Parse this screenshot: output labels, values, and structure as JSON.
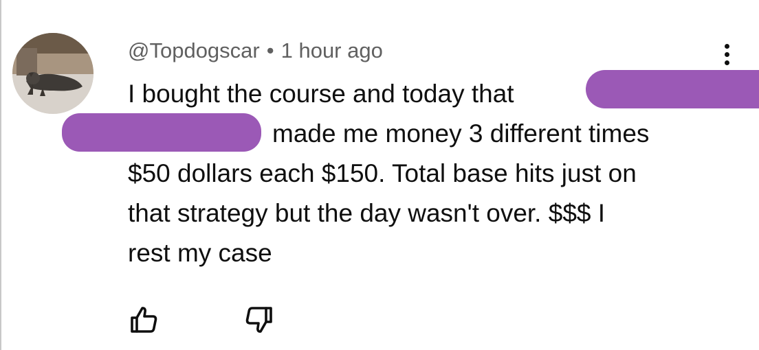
{
  "comment": {
    "author": "@Topdogscar",
    "separator": "•",
    "timestamp": "1 hour ago",
    "lines": [
      "I bought the course and today that",
      "made me money 3 different times",
      "$50 dollars each $150. Total base hits just on",
      "that strategy but the day wasn't over. $$$ I",
      "rest my case"
    ]
  },
  "icons": {
    "avatar": "dog-photo-avatar",
    "more": "more-vertical-icon",
    "like": "thumbs-up-icon",
    "dislike": "thumbs-down-icon"
  },
  "colors": {
    "redaction": "#9b59b6",
    "meta_text": "#606060",
    "body_text": "#0f0f0f"
  }
}
